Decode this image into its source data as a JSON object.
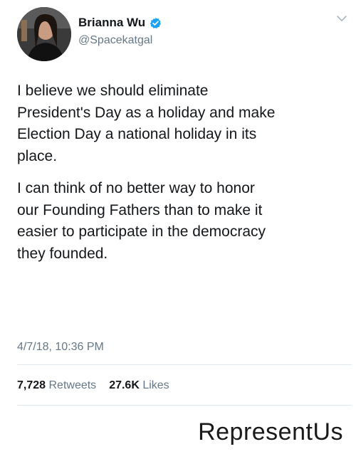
{
  "author": {
    "name": "Brianna Wu",
    "handle": "@Spacekatgal",
    "verified_icon": "verified-badge-icon",
    "verified_color": "#1da1f2"
  },
  "tweet": {
    "paragraphs": [
      "I believe we should eliminate\nPresident's Day as a holiday and make\nElection Day a national holiday in its\nplace.",
      "I can think of no better way to honor\nour Founding Fathers than to make it\neasier to participate in the democracy\nthey founded."
    ],
    "timestamp": "4/7/18, 10:36 PM"
  },
  "stats": {
    "retweets_count": "7,728",
    "retweets_label": "Retweets",
    "likes_count": "27.6K",
    "likes_label": "Likes"
  },
  "watermark": "RepresentUs",
  "menu_icon": "chevron-down-icon"
}
